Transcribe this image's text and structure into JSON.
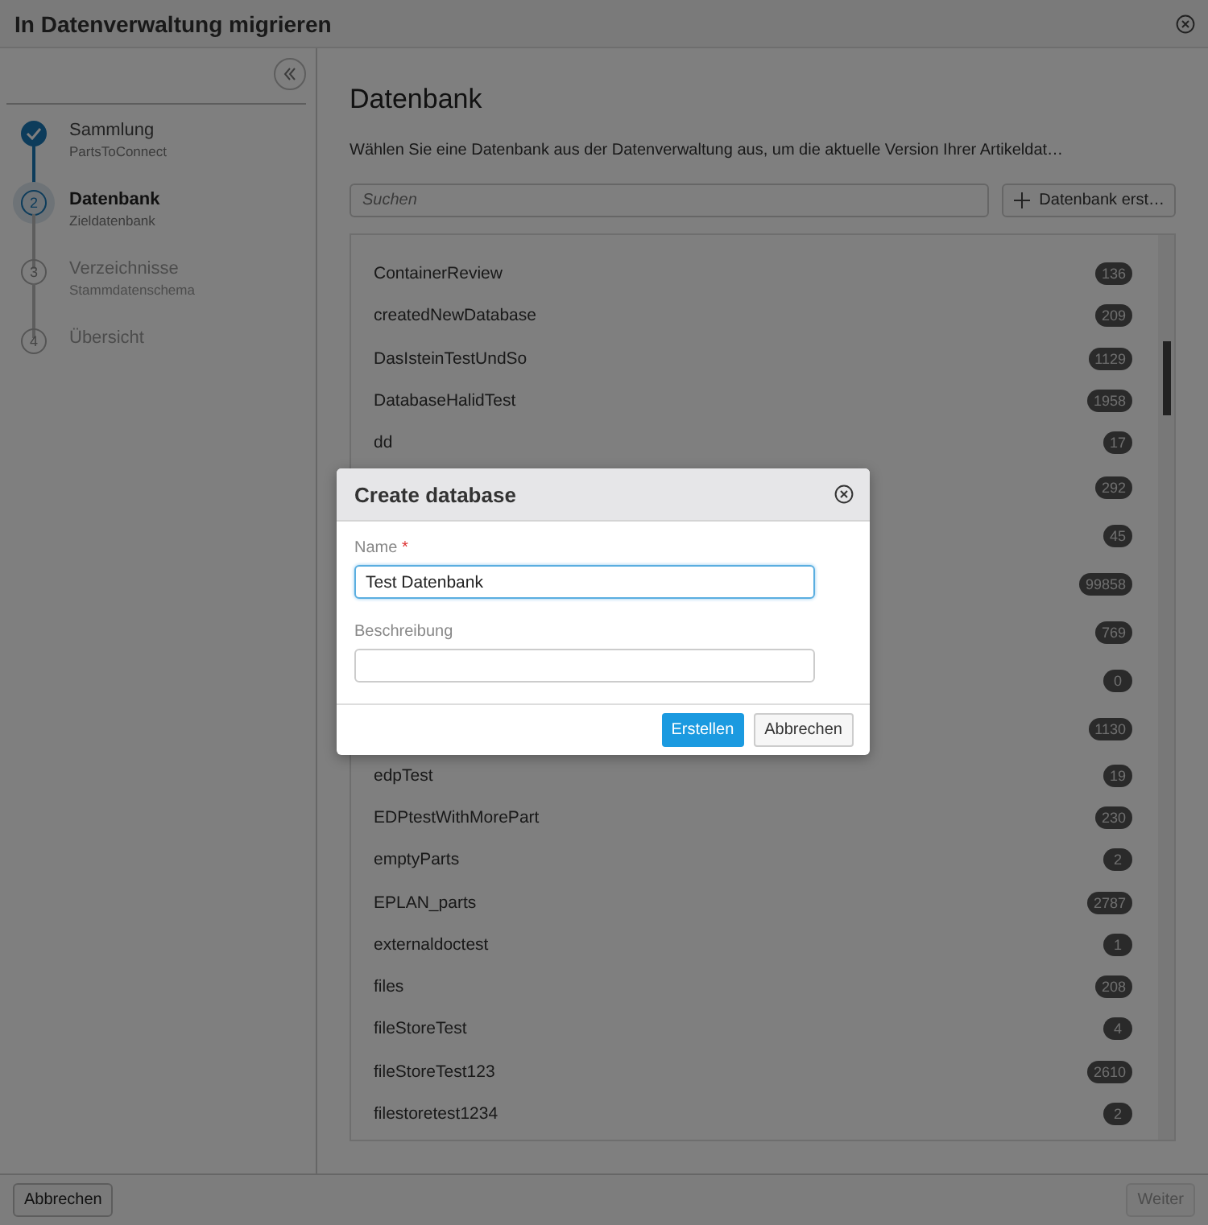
{
  "window": {
    "title": "In Datenverwaltung migrieren"
  },
  "steps": [
    {
      "title": "Sammlung",
      "subtitle": "PartsToConnect",
      "completed": true,
      "selected": false
    },
    {
      "title": "Datenbank",
      "subtitle": "Zieldatenbank",
      "number": "2",
      "completed": false,
      "selected": true
    },
    {
      "title": "Verzeichnisse",
      "subtitle": "Stammdatenschema",
      "number": "3",
      "completed": false,
      "selected": false
    },
    {
      "title": "Übersicht",
      "number": "4",
      "completed": false,
      "selected": false
    }
  ],
  "main": {
    "heading": "Datenbank",
    "description": "Wählen Sie eine Datenbank aus der Datenverwaltung aus, um die aktuelle Version Ihrer Artikeldat…",
    "search": {
      "placeholder": "Suchen"
    },
    "create_button": "Datenbank erst…"
  },
  "databases": [
    {
      "name": "ContainerReview",
      "count": "136"
    },
    {
      "name": "createdNewDatabase",
      "count": "209"
    },
    {
      "name": "DasIsteinTestUndSo",
      "count": "1129"
    },
    {
      "name": "DatabaseHalidTest",
      "count": "1958"
    },
    {
      "name": "dd",
      "count": "17"
    },
    {
      "count": "292"
    },
    {
      "count": "45"
    },
    {
      "count": "99858"
    },
    {
      "count": "769"
    },
    {
      "count": "0"
    },
    {
      "count": "1130"
    },
    {
      "name": "edpTest",
      "count": "19"
    },
    {
      "name": "EDPtestWithMorePart",
      "count": "230"
    },
    {
      "name": "emptyParts",
      "count": "2"
    },
    {
      "name": "EPLAN_parts",
      "count": "2787"
    },
    {
      "name": "externaldoctest",
      "count": "1"
    },
    {
      "name": "files",
      "count": "208"
    },
    {
      "name": "fileStoreTest",
      "count": "4"
    },
    {
      "name": "fileStoreTest123",
      "count": "2610"
    },
    {
      "name": "filestoretest1234",
      "count": "2"
    }
  ],
  "footer": {
    "cancel": "Abbrechen",
    "next": "Weiter"
  },
  "dialog": {
    "title": "Create database",
    "name_label": "Name",
    "required_mark": "*",
    "name_value": "Test Datenbank",
    "description_label": "Beschreibung",
    "submit": "Erstellen",
    "cancel": "Abbrechen"
  }
}
